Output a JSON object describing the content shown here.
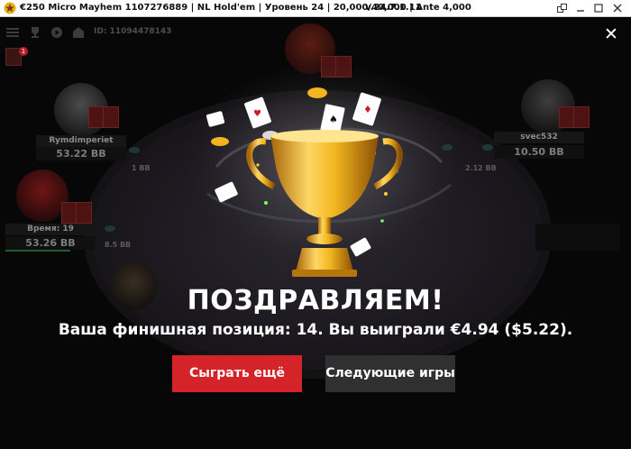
{
  "window": {
    "title": "€250 Micro Mayhem 1107276889 | NL Hold'em | Уровень 24 | 20,000/40,000 | Ante 4,000",
    "version": "v.24.7.1.11"
  },
  "table": {
    "id_label": "ID: 11094478143",
    "notification_count": "1"
  },
  "seats": [
    {
      "name": "Rymdimperiet",
      "stack": "53.22 BB",
      "bet": "1 BB"
    },
    {
      "name": "svec532",
      "stack": "10.50 BB",
      "bet": "2.12 BB"
    },
    {
      "name": "Время: 19",
      "stack": "53.26 BB",
      "bet": "8.5 BB"
    }
  ],
  "overlay": {
    "headline": "ПОЗДРАВЛЯЕМ!",
    "message": "Ваша финишная позиция: 14. Вы выиграли €4.94 ($5.22).",
    "play_again_label": "Сыграть ещё",
    "next_games_label": "Следующие игры"
  },
  "colors": {
    "accent_red": "#d5232a",
    "secondary_button": "#303030",
    "trophy_gold": "#f2b51f"
  }
}
